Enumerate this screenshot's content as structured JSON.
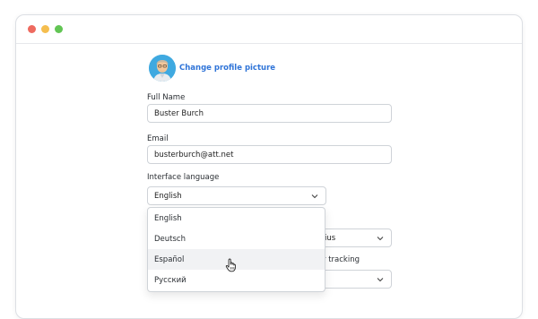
{
  "window": {
    "controls": [
      "close",
      "minimize",
      "maximize"
    ]
  },
  "profile": {
    "change_picture_label": "Change profile picture",
    "avatar_icon": "user-avatar-icon"
  },
  "full_name": {
    "label": "Full Name",
    "value": "Buster Burch"
  },
  "email": {
    "label": "Email",
    "value": "busterburch@att.net"
  },
  "language": {
    "label": "Interface language",
    "selected": "English",
    "options": [
      "English",
      "Deutsch",
      "Español",
      "Русский"
    ],
    "hovered": "Español"
  },
  "obscured": {
    "select_fragment": "ius",
    "label_fragment": "r tracking"
  },
  "colors": {
    "link": "#2f74d8",
    "hover_row": "#f1f2f4",
    "avatar_bg": "#3fa9e0"
  }
}
